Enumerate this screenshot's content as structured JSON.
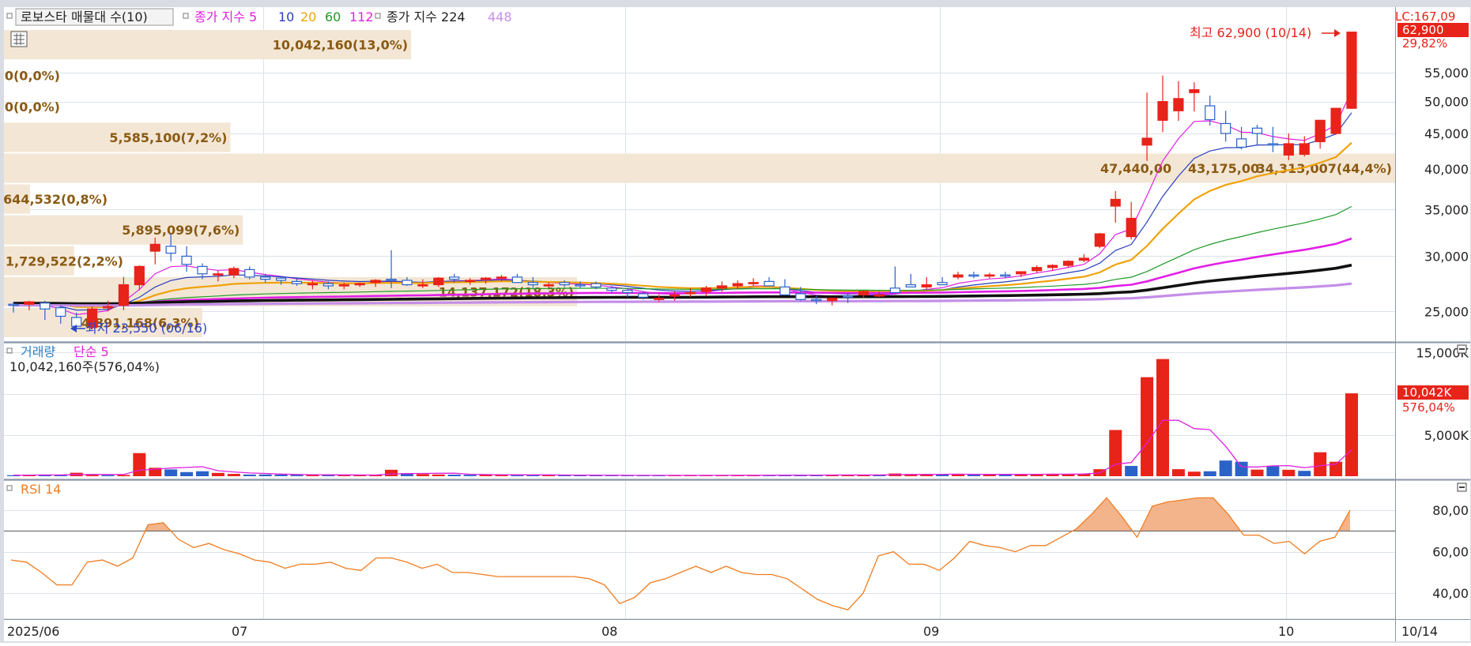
{
  "app": {
    "legend_title": "로보스타 매물대 수(10)",
    "ma_legend_label": "종가 지수 5",
    "ma_periods": [
      "10",
      "20",
      "60",
      "112"
    ],
    "ma2_legend_label": "종가 지수 224",
    "ma2_extra_period": "448",
    "max_marker": "최고 62,900 (10/14)",
    "min_marker": "최저 23,550 (06/16)",
    "top_price_label": "LC:167,09",
    "current_price": "62,900",
    "current_change": "29,82%",
    "volume_legend": [
      "거래량",
      "단순 5"
    ],
    "volume_info": "10,042,160주(576,04%)",
    "current_volume": "10,042K",
    "current_volume_pct": "576,04%",
    "rsi_legend": "RSI 14",
    "date_labels": [
      "2025/06",
      "07",
      "08",
      "09",
      "10"
    ],
    "current_date": "10/14"
  },
  "colors": {
    "up": "#e82319",
    "down": "#2a62c8",
    "ma5": "#e020e0",
    "ma10": "#2a3ebe",
    "ma20": "#f0a20a",
    "ma60": "#1e9a28",
    "ma112": "#e11fe6",
    "ma224": "#111111",
    "ma448": "#c48ee8",
    "vp_bar": "#f3e6d5",
    "vp_text": "#8a5a12",
    "rsi": "#f07c1f",
    "rsi_fill": "#f3b48c",
    "grid": "#dbe2ea",
    "axis_bg": "#ffffff",
    "marker_red": "#e82319",
    "marker_blue": "#2a44c8"
  },
  "chart_data": [
    {
      "type": "candlestick",
      "title": "로보스타 매물대 수(10)",
      "y_scale": "log",
      "ylim": [
        23500,
        63500
      ],
      "y_ticks": [
        25000,
        30000,
        35000,
        40000,
        45000,
        50000,
        55000
      ],
      "y_tick_labels": [
        "25,000",
        "30,000",
        "35,000",
        "40,000",
        "45,000",
        "50,000",
        "55,000"
      ],
      "x_tick_labels": [
        "2025/06",
        "07",
        "08",
        "09",
        "10"
      ],
      "x_tick_dates": [
        "2025-06-09",
        "2025-07-01",
        "2025-08-01",
        "2025-09-01",
        "2025-10-01"
      ],
      "dates": [
        "06/09",
        "06/10",
        "06/11",
        "06/12",
        "06/13",
        "06/16",
        "06/17",
        "06/18",
        "06/19",
        "06/20",
        "06/23",
        "06/24",
        "06/25",
        "06/26",
        "06/27",
        "06/30",
        "07/01",
        "07/02",
        "07/03",
        "07/04",
        "07/07",
        "07/08",
        "07/09",
        "07/10",
        "07/11",
        "07/14",
        "07/15",
        "07/16",
        "07/17",
        "07/18",
        "07/21",
        "07/22",
        "07/23",
        "07/24",
        "07/25",
        "07/28",
        "07/29",
        "07/30",
        "07/31",
        "08/01",
        "08/04",
        "08/05",
        "08/06",
        "08/07",
        "08/08",
        "08/11",
        "08/12",
        "08/13",
        "08/14",
        "08/18",
        "08/19",
        "08/20",
        "08/21",
        "08/22",
        "08/25",
        "08/26",
        "08/27",
        "08/28",
        "08/29",
        "09/01",
        "09/02",
        "09/03",
        "09/04",
        "09/05",
        "09/08",
        "09/09",
        "09/10",
        "09/11",
        "09/12",
        "09/15",
        "09/16",
        "09/17",
        "09/18",
        "09/19",
        "09/22",
        "09/23",
        "09/24",
        "09/25",
        "09/26",
        "09/29",
        "09/30",
        "10/01",
        "10/02",
        "10/10",
        "10/13",
        "10/14"
      ],
      "open": [
        25600,
        25600,
        25700,
        25300,
        24500,
        23700,
        25300,
        25500,
        27300,
        30500,
        31000,
        30000,
        29000,
        28200,
        28200,
        28700,
        28000,
        27900,
        27600,
        27300,
        27400,
        27200,
        27300,
        27500,
        27800,
        27700,
        27200,
        27300,
        28000,
        27600,
        27800,
        27900,
        28000,
        27500,
        27300,
        27500,
        27300,
        27400,
        27000,
        26800,
        26500,
        26100,
        26300,
        26500,
        26700,
        27000,
        27200,
        27400,
        27600,
        27100,
        26500,
        26000,
        25900,
        26300,
        26400,
        26400,
        27000,
        27300,
        27100,
        27500,
        28000,
        28200,
        28100,
        28200,
        28300,
        28600,
        28900,
        29100,
        29600,
        31000,
        35400,
        32000,
        43300,
        47000,
        48500,
        51500,
        49300,
        46500,
        44200,
        45800,
        43500,
        41900,
        42000,
        43800,
        45000,
        48900
      ],
      "high": [
        25800,
        25900,
        25900,
        25500,
        24900,
        25400,
        25900,
        28000,
        29100,
        31900,
        32300,
        31000,
        29300,
        28600,
        29000,
        29000,
        28300,
        28100,
        27900,
        27700,
        27600,
        27500,
        27500,
        27800,
        30600,
        28000,
        27800,
        28000,
        28300,
        27900,
        28000,
        28200,
        28300,
        28000,
        27500,
        27700,
        27600,
        27600,
        27200,
        27000,
        26700,
        26400,
        26700,
        27000,
        27200,
        27600,
        27700,
        27900,
        28000,
        27800,
        27100,
        26400,
        26100,
        26500,
        26800,
        26700,
        29000,
        28300,
        28000,
        28000,
        28500,
        28500,
        28400,
        28500,
        28500,
        29100,
        29200,
        29600,
        30200,
        32400,
        37200,
        35900,
        51500,
        54500,
        53500,
        53300,
        51000,
        48500,
        46000,
        46300,
        46000,
        45000,
        44600,
        46500,
        47700,
        62900
      ],
      "low": [
        24900,
        25100,
        24300,
        24000,
        23600,
        23550,
        25000,
        25100,
        26800,
        29200,
        29500,
        28500,
        27800,
        27600,
        27900,
        27800,
        27500,
        27300,
        27200,
        26900,
        26900,
        26900,
        27100,
        27100,
        27000,
        27200,
        27000,
        27100,
        27500,
        27300,
        27400,
        27600,
        27500,
        27000,
        27000,
        27100,
        27000,
        26900,
        26600,
        26200,
        26000,
        25800,
        25900,
        26200,
        26300,
        26700,
        26900,
        27200,
        27200,
        26400,
        25900,
        25600,
        25500,
        25700,
        26100,
        26200,
        26800,
        27100,
        26900,
        27300,
        27800,
        27900,
        27900,
        27900,
        28000,
        28400,
        28600,
        28900,
        29400,
        30800,
        33500,
        31700,
        41100,
        45200,
        46900,
        48400,
        46200,
        43800,
        42700,
        43200,
        42300,
        41200,
        41700,
        42800,
        44800,
        48800
      ],
      "close": [
        25500,
        25800,
        25200,
        24600,
        23800,
        25200,
        25400,
        27300,
        29000,
        31200,
        30300,
        29200,
        28300,
        28300,
        28800,
        28000,
        27800,
        27700,
        27400,
        27400,
        27200,
        27300,
        27400,
        27700,
        27700,
        27300,
        27300,
        27900,
        27800,
        27700,
        27900,
        28000,
        27500,
        27300,
        27300,
        27300,
        27200,
        27100,
        26800,
        26600,
        26200,
        26100,
        26400,
        26600,
        27000,
        27200,
        27400,
        27500,
        27200,
        26400,
        26000,
        25900,
        26100,
        26200,
        26700,
        26400,
        26600,
        27100,
        27300,
        27300,
        28200,
        28100,
        28200,
        28100,
        28500,
        28900,
        29100,
        29500,
        29800,
        32300,
        36200,
        34000,
        44300,
        50000,
        50500,
        52000,
        47100,
        45000,
        43000,
        45000,
        43400,
        43500,
        43500,
        47000,
        48900,
        62900
      ],
      "ma_periods": [
        5,
        10,
        20,
        60,
        112,
        224,
        448
      ],
      "volume_profile": [
        {
          "label": "10,042,160(13,0%)",
          "value": 10042160,
          "pct": 13.0
        },
        {
          "label": "0(0,0%)",
          "value": 0,
          "pct": 0.0
        },
        {
          "label": "0(0,0%)",
          "value": 0,
          "pct": 0.0
        },
        {
          "label": "5,585,100(7,2%)",
          "value": 5585100,
          "pct": 7.2
        },
        {
          "label": "34,313,007(44,4%)",
          "value": 34313007,
          "pct": 44.4
        },
        {
          "label": "644,532(0,8%)",
          "value": 644532,
          "pct": 0.8
        },
        {
          "label": "5,895,099(7,6%)",
          "value": 5895099,
          "pct": 7.6
        },
        {
          "label": "1,729,522(2,2%)",
          "value": 1729522,
          "pct": 2.2
        },
        {
          "label": "14,137,172(18,3%)",
          "value": 14137172,
          "pct": 18.3
        },
        {
          "label": "4,891,168(6,3%)",
          "value": 4891168,
          "pct": 6.3
        }
      ],
      "overlapped_labels": [
        "47,440,00",
        "43,175,00"
      ],
      "max_marker": {
        "date": "10/14",
        "price": 62900
      },
      "min_marker": {
        "date": "06/16",
        "price": 23550
      }
    },
    {
      "type": "bar",
      "title": "거래량",
      "ylim": [
        0,
        15600000
      ],
      "y_ticks": [
        5000000,
        10000000,
        15000000
      ],
      "y_tick_labels": [
        "5,000K",
        "10,000K",
        "15,000K"
      ],
      "current_label": "10,042K",
      "current_pct": "576,04%",
      "ma_period": 5,
      "volume": [
        120000,
        150000,
        180000,
        160000,
        420000,
        140000,
        130000,
        150000,
        2800000,
        1020000,
        820000,
        500000,
        600000,
        400000,
        280000,
        200000,
        210000,
        190000,
        170000,
        160000,
        150000,
        140000,
        130000,
        150000,
        780000,
        370000,
        260000,
        210000,
        190000,
        170000,
        180000,
        160000,
        170000,
        150000,
        130000,
        120000,
        110000,
        110000,
        100000,
        110000,
        120000,
        90000,
        100000,
        110000,
        100000,
        120000,
        130000,
        110000,
        100000,
        140000,
        150000,
        160000,
        170000,
        160000,
        140000,
        150000,
        330000,
        260000,
        210000,
        200000,
        230000,
        210000,
        240000,
        220000,
        200000,
        260000,
        300000,
        280000,
        290000,
        850000,
        5600000,
        1250000,
        12000000,
        14200000,
        850000,
        550000,
        600000,
        1900000,
        1750000,
        800000,
        1200000,
        780000,
        650000,
        2900000,
        1750000,
        10042160
      ],
      "up": [
        false,
        true,
        false,
        false,
        true,
        true,
        false,
        true,
        true,
        true,
        false,
        false,
        false,
        true,
        true,
        false,
        false,
        false,
        false,
        true,
        false,
        true,
        true,
        true,
        true,
        false,
        true,
        true,
        false,
        false,
        true,
        true,
        false,
        false,
        true,
        false,
        false,
        false,
        false,
        false,
        false,
        false,
        true,
        true,
        true,
        true,
        true,
        true,
        false,
        false,
        false,
        false,
        true,
        true,
        true,
        false,
        true,
        true,
        true,
        false,
        true,
        false,
        true,
        false,
        true,
        true,
        true,
        true,
        true,
        true,
        true,
        false,
        true,
        true,
        true,
        true,
        false,
        false,
        false,
        true,
        false,
        true,
        false,
        true,
        true,
        true
      ]
    },
    {
      "type": "line",
      "title": "RSI 14",
      "ylim": [
        29,
        93
      ],
      "y_ticks": [
        40,
        60,
        80
      ],
      "y_tick_labels": [
        "40,00",
        "60,00",
        "80,00"
      ],
      "threshold": 70,
      "values": [
        56,
        55,
        50,
        44,
        44,
        55,
        56,
        53,
        57,
        73,
        74,
        66,
        62,
        64,
        61,
        59,
        56,
        55,
        52,
        54,
        54,
        55,
        52,
        51,
        57,
        57,
        55,
        52,
        54,
        50,
        50,
        49,
        48,
        48,
        48,
        48,
        48,
        48,
        47,
        44,
        35,
        38,
        45,
        47,
        50,
        53,
        50,
        53,
        50,
        49,
        49,
        47,
        42,
        37,
        34,
        32,
        40,
        58,
        60,
        54,
        54,
        51,
        57,
        65,
        63,
        62,
        60,
        63,
        63,
        67,
        71,
        78,
        86,
        77,
        67,
        82,
        84,
        85,
        86,
        86,
        78,
        68,
        68,
        64,
        65,
        59,
        65,
        67,
        80
      ]
    }
  ]
}
